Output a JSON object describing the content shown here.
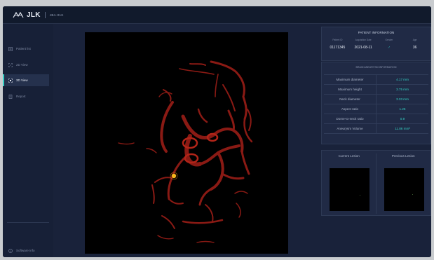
{
  "topbar": {
    "brand": "JLK",
    "product": "JBA-01K"
  },
  "sidebar": {
    "items": [
      {
        "label": "Patient list",
        "icon": "list-icon"
      },
      {
        "label": "2D View",
        "icon": "scan-2d-icon"
      },
      {
        "label": "3D View",
        "icon": "cube-3d-icon",
        "active": true
      },
      {
        "label": "Report",
        "icon": "report-icon"
      }
    ],
    "footer_label": "Software Info"
  },
  "patient_info": {
    "title": "PATIENT INFORMATION",
    "headers": [
      "Patient ID",
      "Acquisition Date",
      "Gender",
      "Age"
    ],
    "values": {
      "patient_id": "01171345",
      "acquisition_date": "2021-08-11",
      "gender": "♂",
      "age": "36"
    }
  },
  "aneurysm": {
    "title": "BRAIN ANEURYSM INFORMATION",
    "rows": [
      {
        "label": "Maximum diameter",
        "value": "4.17 mm"
      },
      {
        "label": "Maximum height",
        "value": "3.75 mm"
      },
      {
        "label": "Neck diameter",
        "value": "3.33 mm"
      },
      {
        "label": "Aspect ratio",
        "value": "1.25"
      },
      {
        "label": "Dome-to-neck ratio",
        "value": "0.9"
      },
      {
        "label": "Aneurysm Volume",
        "value": "11.86 mm³"
      }
    ]
  },
  "lesion": {
    "current_label": "Current Lesion",
    "previous_label": "Previous Lesion"
  },
  "colors": {
    "accent": "#35d3c6",
    "vessel": "#8a1a14",
    "aneurysm": "#f3b61c"
  }
}
